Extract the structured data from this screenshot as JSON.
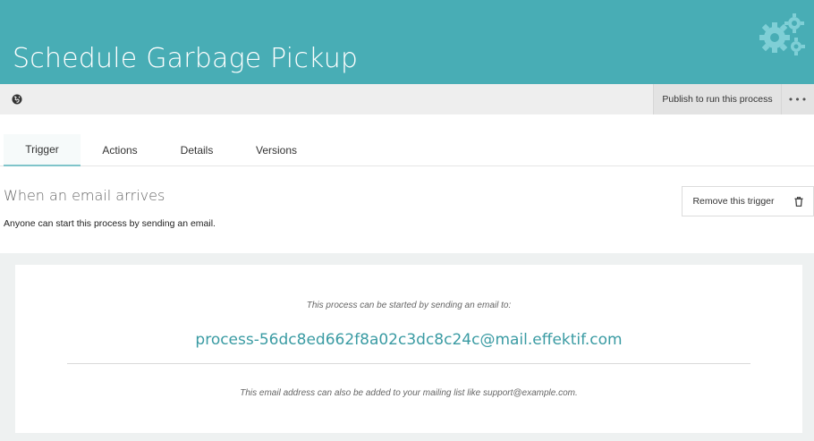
{
  "header": {
    "title": "Schedule Garbage Pickup",
    "icon": "gears-icon",
    "background": "#48adb5"
  },
  "toolbar": {
    "globe_icon": "globe-icon",
    "publish_label": "Publish to run this process",
    "more_label": "•••"
  },
  "tabs": [
    {
      "label": "Trigger",
      "active": true
    },
    {
      "label": "Actions",
      "active": false
    },
    {
      "label": "Details",
      "active": false
    },
    {
      "label": "Versions",
      "active": false
    }
  ],
  "trigger": {
    "title": "When an email arrives",
    "description": "Anyone can start this process by sending an email.",
    "remove_label": "Remove this trigger",
    "trash_icon": "trash-icon"
  },
  "panel": {
    "intro": "This process can be started by sending an email to:",
    "email": "process-56dc8ed662f8a02c3dc8c24c@mail.effektif.com",
    "note": "This email address can also be added to your mailing list like support@example.com."
  },
  "colors": {
    "accent": "#48adb5",
    "link": "#3a9ba3",
    "tab_underline": "#7fc4ca"
  }
}
